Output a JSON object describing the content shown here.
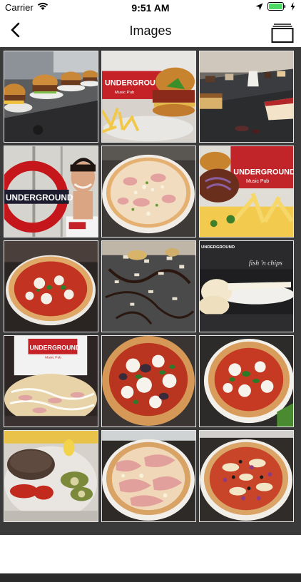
{
  "status": {
    "carrier": "Carrier",
    "time": "9:51 AM"
  },
  "nav": {
    "title": "Images"
  },
  "images": [
    {
      "subject": "burgers on counter"
    },
    {
      "subject": "burger with fries, Underground Music Pub"
    },
    {
      "subject": "desserts on slate plate"
    },
    {
      "subject": "man at Underground sign"
    },
    {
      "subject": "pizza with ham and cheese"
    },
    {
      "subject": "pulled pork with fries, Underground Music Pub"
    },
    {
      "subject": "margherita pizza"
    },
    {
      "subject": "chocolate dessert on slate"
    },
    {
      "subject": "fish n chips"
    },
    {
      "subject": "Underground staff holding pizza"
    },
    {
      "subject": "pizza with basil and eggplant"
    },
    {
      "subject": "pizza with basil and tomato"
    },
    {
      "subject": "grilled burger patty with vegetables"
    },
    {
      "subject": "pizza with prosciutto"
    },
    {
      "subject": "pizza with onions and olives"
    }
  ],
  "brand": {
    "underground": "UNDERGROUND",
    "music_pub": "Music Pub",
    "fish_chips": "fish 'n chips"
  }
}
